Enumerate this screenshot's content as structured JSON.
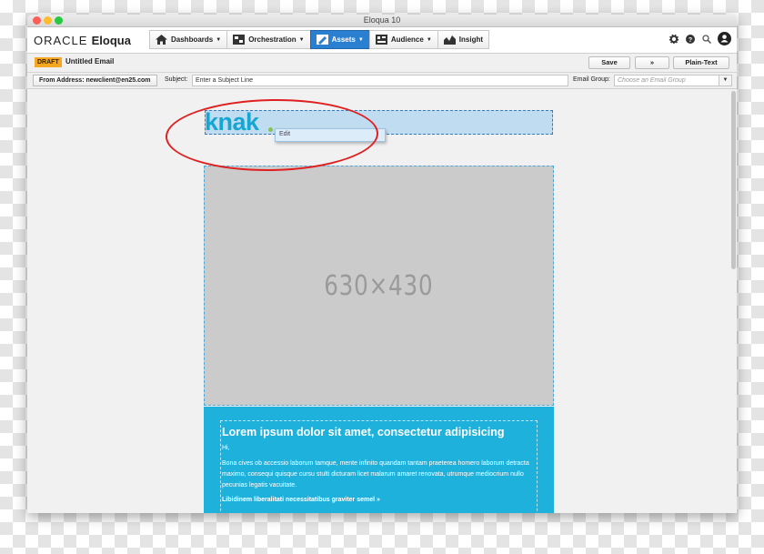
{
  "window": {
    "title": "Eloqua 10"
  },
  "appbar": {
    "logo_oracle": "ORACLE",
    "logo_eloqua": "Eloqua",
    "nav": [
      {
        "label": "Dashboards",
        "icon": "home-icon",
        "has_menu": true
      },
      {
        "label": "Orchestration",
        "icon": "orchestration-icon",
        "has_menu": true
      },
      {
        "label": "Assets",
        "icon": "assets-icon",
        "has_menu": true,
        "active": true
      },
      {
        "label": "Audience",
        "icon": "audience-icon",
        "has_menu": true
      },
      {
        "label": "Insight",
        "icon": "insight-icon",
        "has_menu": false
      }
    ],
    "tools": [
      "gear-icon",
      "help-icon",
      "search-icon",
      "user-icon"
    ],
    "active_color": "#2b7fd0"
  },
  "toolbar": {
    "status_badge": "DRAFT",
    "email_name": "Untitled Email",
    "save_label": "Save",
    "more_label": "»",
    "plain_text_label": "Plain-Text"
  },
  "properties": {
    "from_address": "From Address: newclient@en25.com",
    "subject_label": "Subject:",
    "subject_value": "Enter a Subject Line",
    "email_group_label": "Email Group:",
    "email_group_placeholder": "Choose an Email Group"
  },
  "canvas": {
    "brand_text": "knak",
    "brand_color": "#16a6d3",
    "context_menu_item": "Edit",
    "placeholder_text": "630×430",
    "content": {
      "heading": "Lorem ipsum dolor sit amet, consectetur adipisicing",
      "greeting": "Hi,",
      "body": "Bona cives ob accessio laborum tamque, mente infinito quandam tantam praeterea homero laborum detracta maximo, consequi quisque cursu stulti dicturam licet malarum amaret renovata, utrumque mediocrium nullo pecunias legatis vacuitate.",
      "cta": "Libidinem liberalitati necessitatibus graviter semel »",
      "background_color": "#1eb1dc"
    },
    "annotation_color": "#e02020"
  }
}
